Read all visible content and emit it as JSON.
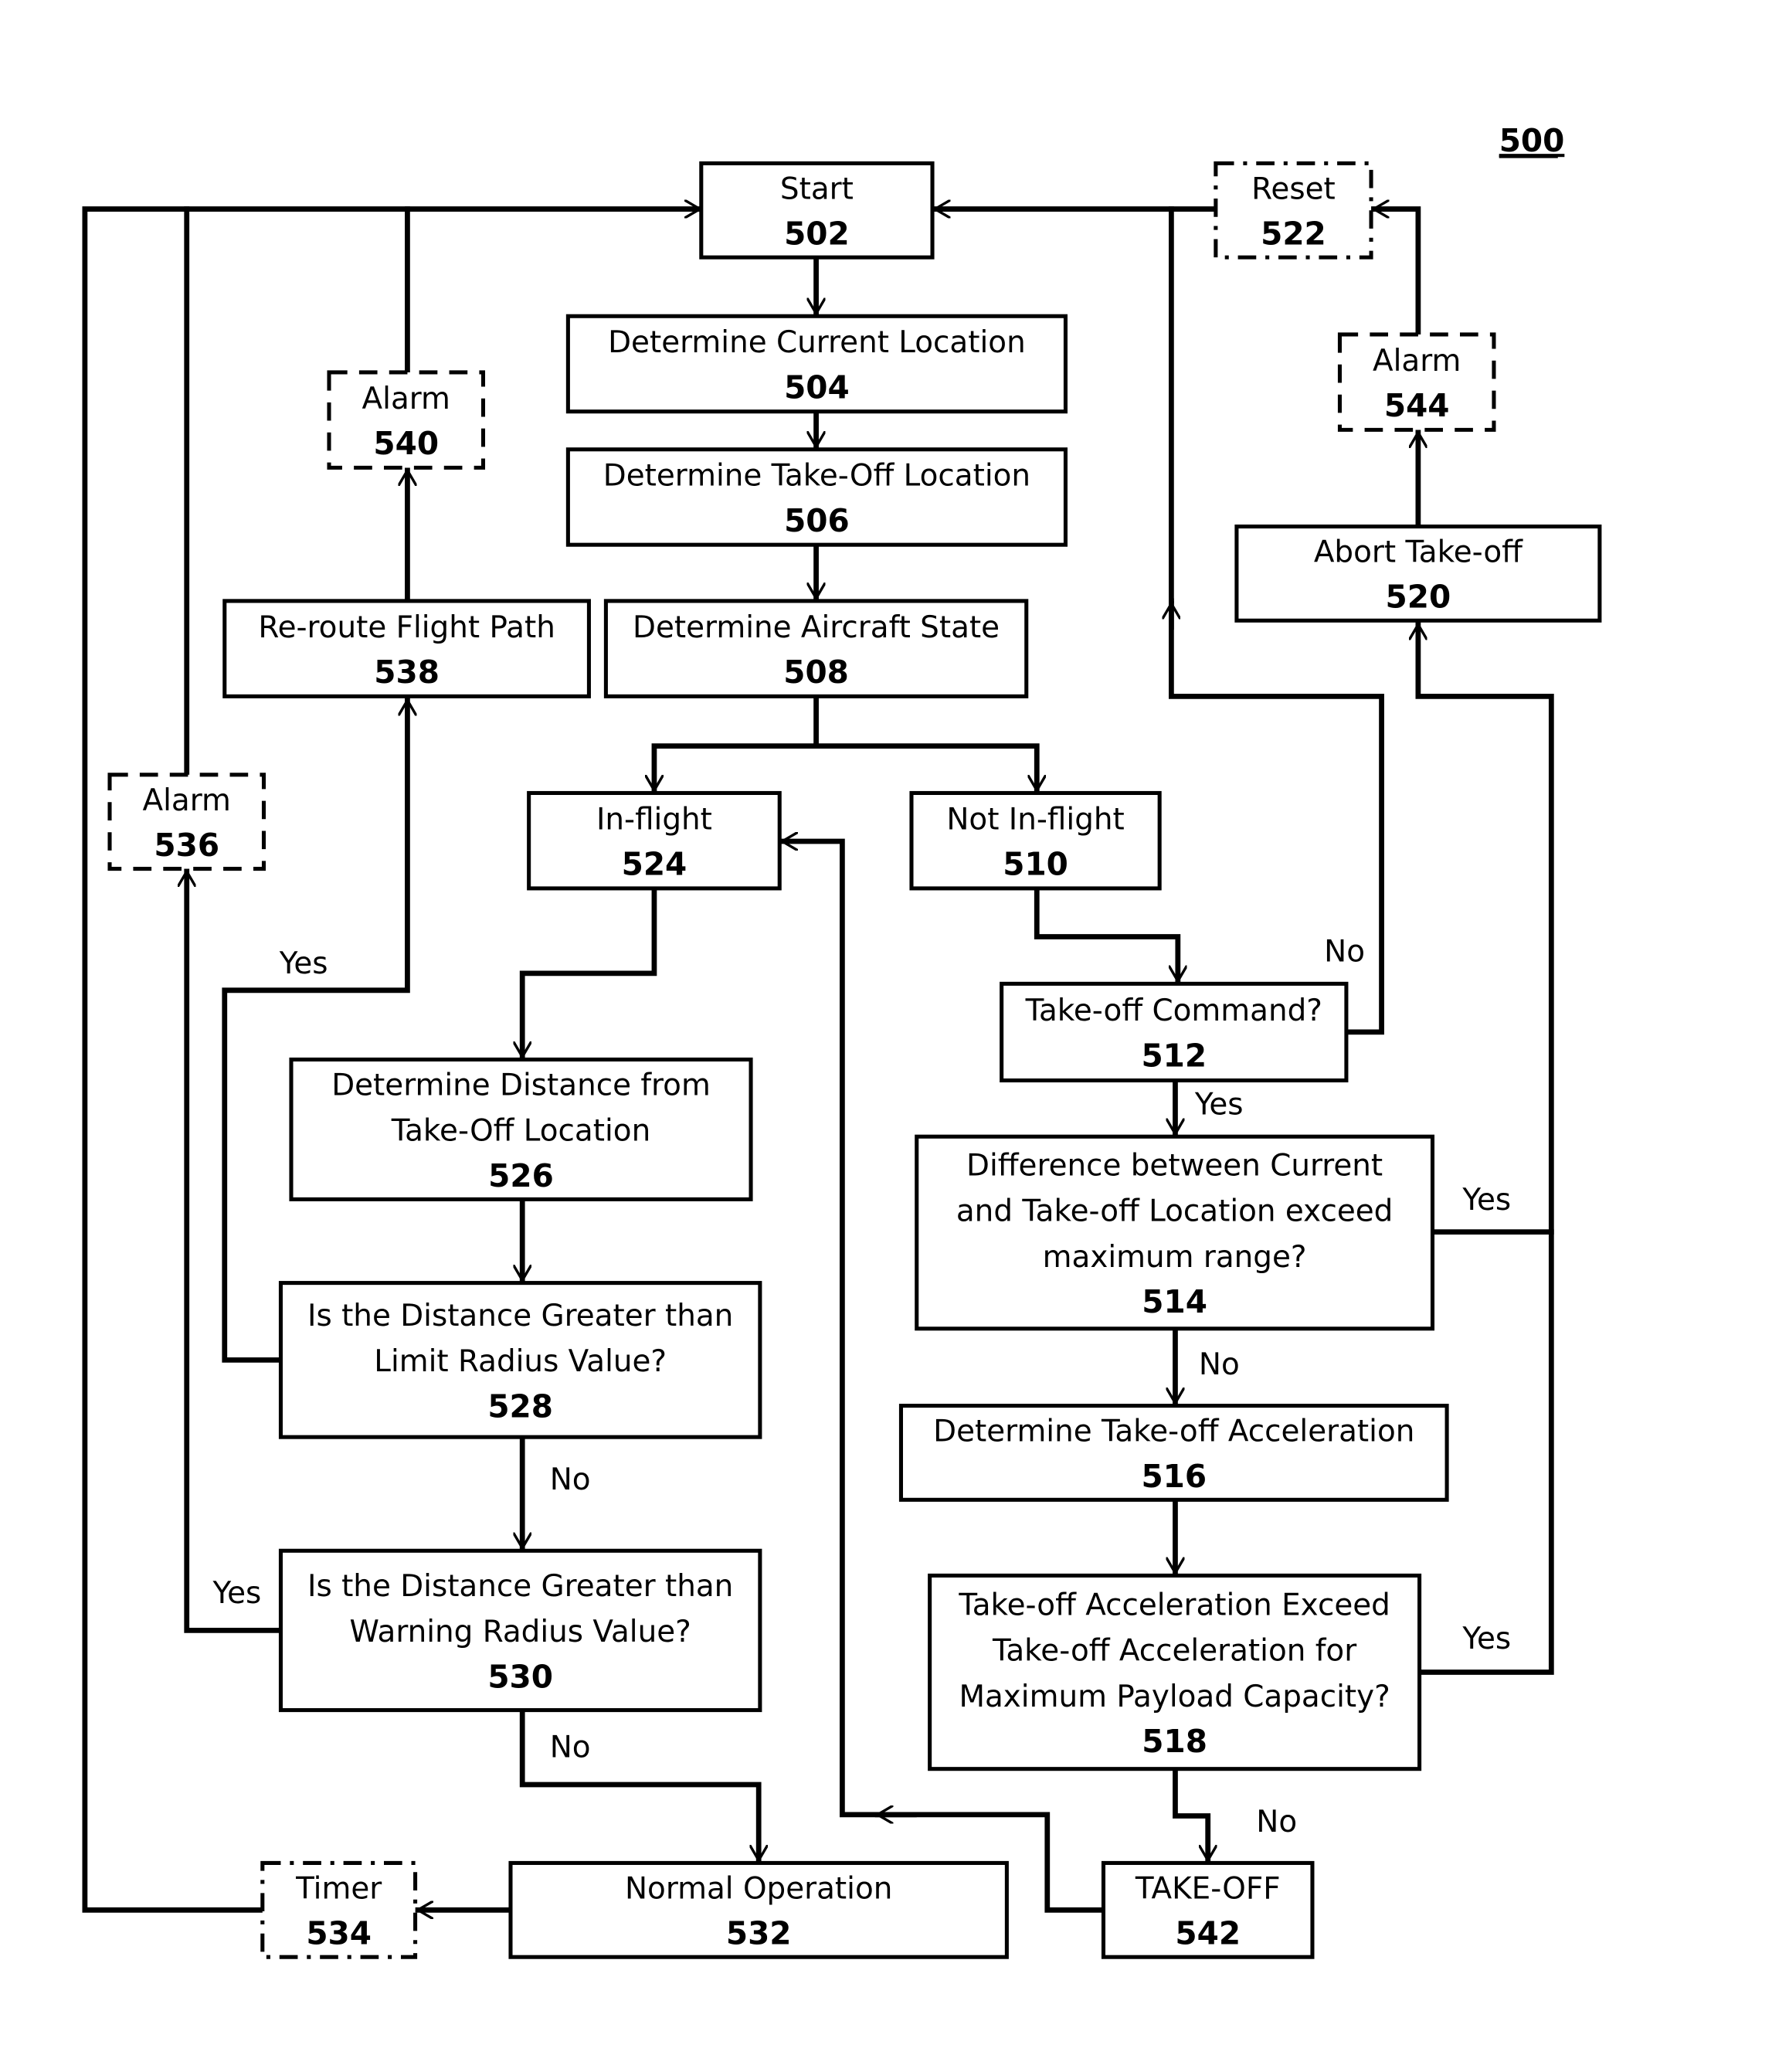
{
  "figure_number": "500",
  "nodes": {
    "n502": {
      "lines": [
        "Start"
      ],
      "ref": "502",
      "style": "solid"
    },
    "n504": {
      "lines": [
        "Determine  Current Location"
      ],
      "ref": "504",
      "style": "solid"
    },
    "n506": {
      "lines": [
        "Determine Take-Off Location"
      ],
      "ref": "506",
      "style": "solid"
    },
    "n508": {
      "lines": [
        "Determine Aircraft State"
      ],
      "ref": "508",
      "style": "solid"
    },
    "n510": {
      "lines": [
        "Not In-flight"
      ],
      "ref": "510",
      "style": "solid"
    },
    "n512": {
      "lines": [
        "Take-off Command?"
      ],
      "ref": "512",
      "style": "solid"
    },
    "n514": {
      "lines": [
        "Difference between Current",
        "and Take-off Location exceed",
        "maximum range?"
      ],
      "ref": "514",
      "style": "solid"
    },
    "n516": {
      "lines": [
        "Determine Take-off Acceleration"
      ],
      "ref": "516",
      "style": "solid"
    },
    "n518": {
      "lines": [
        "Take-off Acceleration Exceed",
        "Take-off Acceleration for",
        "Maximum Payload Capacity?"
      ],
      "ref": "518",
      "style": "solid"
    },
    "n520": {
      "lines": [
        "Abort Take-off"
      ],
      "ref": "520",
      "style": "solid"
    },
    "n522": {
      "lines": [
        "Reset"
      ],
      "ref": "522",
      "style": "dashdot"
    },
    "n524": {
      "lines": [
        "In-flight"
      ],
      "ref": "524",
      "style": "solid"
    },
    "n526": {
      "lines": [
        "Determine Distance from",
        "Take-Off Location"
      ],
      "ref": "526",
      "style": "solid"
    },
    "n528": {
      "lines": [
        "Is the Distance Greater than",
        "Limit Radius Value?"
      ],
      "ref": "528",
      "style": "solid"
    },
    "n530": {
      "lines": [
        "Is the Distance Greater than",
        "Warning Radius Value?"
      ],
      "ref": "530",
      "style": "solid"
    },
    "n532": {
      "lines": [
        "Normal Operation"
      ],
      "ref": "532",
      "style": "solid"
    },
    "n534": {
      "lines": [
        "Timer"
      ],
      "ref": "534",
      "style": "dashdot"
    },
    "n536": {
      "lines": [
        "Alarm"
      ],
      "ref": "536",
      "style": "dashed"
    },
    "n538": {
      "lines": [
        "Re-route Flight Path"
      ],
      "ref": "538",
      "style": "solid"
    },
    "n540": {
      "lines": [
        "Alarm"
      ],
      "ref": "540",
      "style": "dashed"
    },
    "n542": {
      "lines": [
        "TAKE-OFF"
      ],
      "ref": "542",
      "style": "solid"
    },
    "n544": {
      "lines": [
        "Alarm"
      ],
      "ref": "544",
      "style": "dashed"
    }
  },
  "edge_labels": {
    "e512_no": "No",
    "e512_yes": "Yes",
    "e514_yes": "Yes",
    "e514_no": "No",
    "e518_yes": "Yes",
    "e518_no": "No",
    "e528_yes": "Yes",
    "e528_no": "No",
    "e530_yes": "Yes",
    "e530_no": "No"
  }
}
